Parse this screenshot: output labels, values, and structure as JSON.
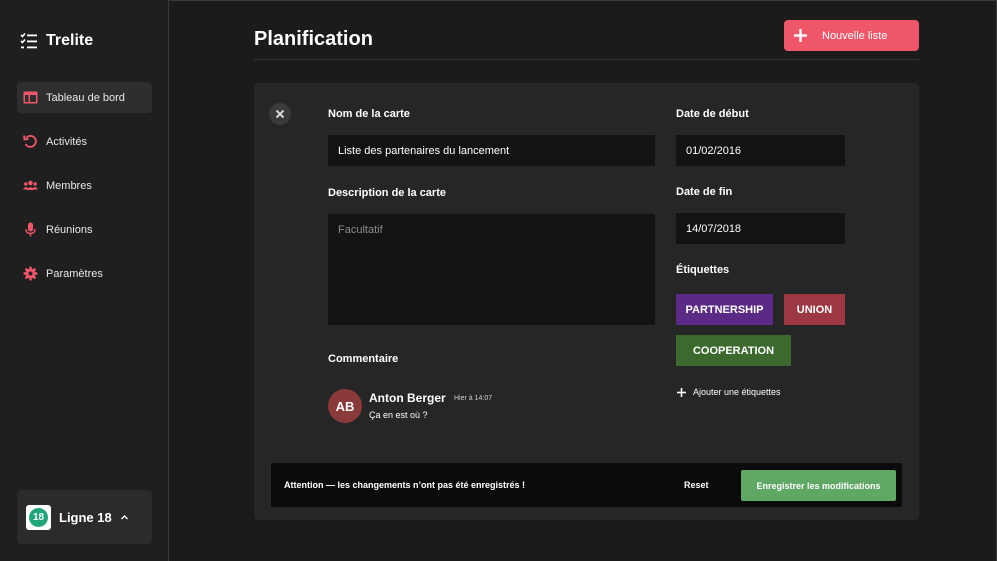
{
  "app": {
    "name": "Trelite"
  },
  "sidebar": {
    "items": [
      {
        "label": "Tableau de bord",
        "icon": "layout-icon",
        "active": true
      },
      {
        "label": "Activités",
        "icon": "history-icon",
        "active": false
      },
      {
        "label": "Membres",
        "icon": "users-icon",
        "active": false
      },
      {
        "label": "Réunions",
        "icon": "microphone-icon",
        "active": false
      },
      {
        "label": "Paramètres",
        "icon": "gear-icon",
        "active": false
      }
    ],
    "workspace": {
      "badge": "18",
      "name": "Ligne 18"
    }
  },
  "header": {
    "title": "Planification",
    "new_list_label": "Nouvelle liste"
  },
  "card": {
    "name_label": "Nom de la carte",
    "name_value": "Liste des partenaires du lancement",
    "description_label": "Description de la carte",
    "description_placeholder": "Facultatif",
    "start_label": "Date de début",
    "start_value": "01/02/2016",
    "end_label": "Date de fin",
    "end_value": "14/07/2018",
    "tags_label": "Étiquettes",
    "tags": [
      {
        "label": "PARTNERSHIP",
        "color": "#5b2a86"
      },
      {
        "label": "UNION",
        "color": "#9b3842"
      },
      {
        "label": "COOPERATION",
        "color": "#3c6a2e"
      }
    ],
    "add_tag_label": "Ajouter une étiquettes",
    "comment_label": "Commentaire",
    "comment": {
      "initials": "AB",
      "author": "Anton Berger",
      "time": "Hier à 14:07",
      "text": "Ça en est où ?"
    }
  },
  "unsaved": {
    "message": "Attention — les changements n’ont pas été enregistrés !",
    "reset_label": "Reset",
    "save_label": "Enregistrer les modifications"
  },
  "colors": {
    "accent": "#f0566a",
    "success": "#5fa864",
    "background": "#1b1b1b",
    "panel": "#262626"
  }
}
